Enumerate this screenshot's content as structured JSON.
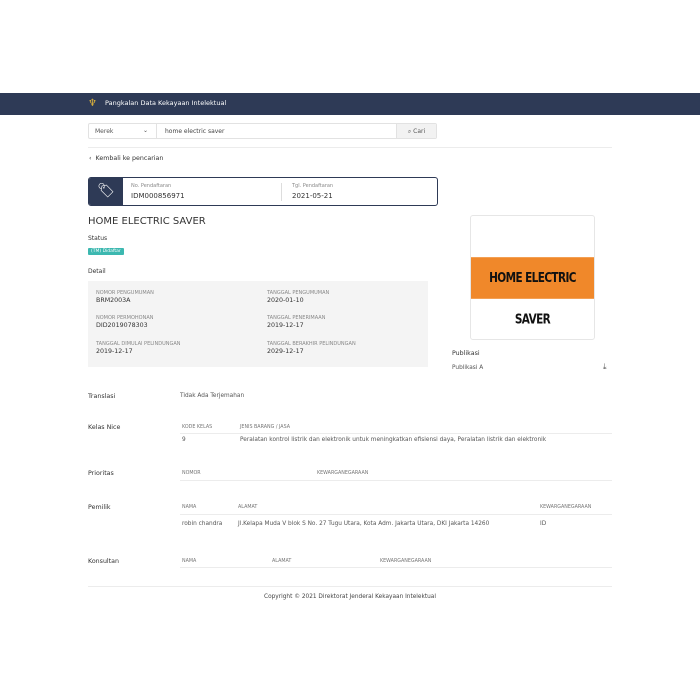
{
  "header": {
    "title": "Pangkalan Data Kekayaan Intelektual"
  },
  "search": {
    "category": "Merek",
    "query": "home electric saver",
    "button": "Cari"
  },
  "back_link": "Kembali ke pencarian",
  "registration": {
    "no_label": "No. Pendaftaran",
    "no_value": "IDM000856971",
    "date_label": "Tgl. Pendaftaran",
    "date_value": "2021-05-21"
  },
  "title": "HOME ELECTRIC SAVER",
  "status": {
    "label": "Status",
    "badge": "(TM) Didaftar"
  },
  "detail": {
    "label": "Detail",
    "fields": [
      {
        "label": "NOMOR PENGUMUMAN",
        "value": "BRM2003A"
      },
      {
        "label": "TANGGAL PENGUMUMAN",
        "value": "2020-01-10"
      },
      {
        "label": "NOMOR PERMOHONAN",
        "value": "DID2019078303"
      },
      {
        "label": "TANGGAL PENERIMAAN",
        "value": "2019-12-17"
      },
      {
        "label": "TANGGAL DIMULAI PELINDUNGAN",
        "value": "2019-12-17"
      },
      {
        "label": "TANGGAL BERAKHIR PELINDUNGAN",
        "value": "2029-12-17"
      }
    ]
  },
  "logo_text": "HOME ELECTRIC SAVER",
  "publikasi": {
    "label": "Publikasi",
    "item": "Publikasi A"
  },
  "translasi": {
    "label": "Translasi",
    "value": "Tidak Ada Terjemahan"
  },
  "kelas_nice": {
    "label": "Kelas Nice",
    "headers": [
      "KODE KELAS",
      "JENIS BARANG / JASA"
    ],
    "rows": [
      [
        "9",
        "Peralatan kontrol listrik dan elektronik untuk meningkatkan efisiensi daya, Peralatan listrik dan elektronik"
      ]
    ]
  },
  "prioritas": {
    "label": "Prioritas",
    "headers": [
      "NOMOR",
      "KEWARGANEGARAAN"
    ]
  },
  "pemilik": {
    "label": "Pemilik",
    "headers": [
      "NAMA",
      "ALAMAT",
      "KEWARGANEGARAAN"
    ],
    "rows": [
      [
        "robin chandra",
        "Jl.Kelapa Muda V blok S No. 27 Tugu Utara, Kota Adm. Jakarta Utara, DKI Jakarta 14260",
        "ID"
      ]
    ]
  },
  "konsultan": {
    "label": "Konsultan",
    "headers": [
      "NAMA",
      "ALAMAT",
      "KEWARGANEGARAAN"
    ]
  },
  "footer": "Copyright © 2021 Direktorat Jenderal Kekayaan Intelektual"
}
